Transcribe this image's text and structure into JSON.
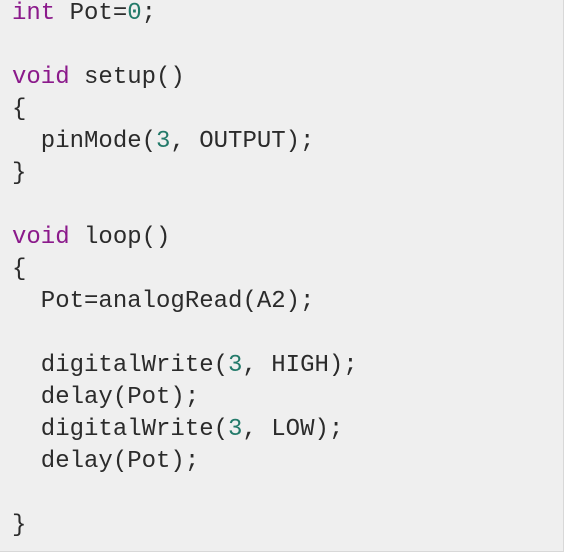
{
  "code_lines": [
    [
      {
        "t": "int",
        "c": "kw"
      },
      {
        "t": " Pot=",
        "c": "txt"
      },
      {
        "t": "0",
        "c": "num"
      },
      {
        "t": ";",
        "c": "txt"
      }
    ],
    [],
    [
      {
        "t": "void",
        "c": "kw"
      },
      {
        "t": " setup()",
        "c": "txt"
      }
    ],
    [
      {
        "t": "{",
        "c": "txt"
      }
    ],
    [
      {
        "t": "  pinMode(",
        "c": "txt"
      },
      {
        "t": "3",
        "c": "num"
      },
      {
        "t": ", OUTPUT);",
        "c": "txt"
      }
    ],
    [
      {
        "t": "}",
        "c": "txt"
      }
    ],
    [],
    [
      {
        "t": "void",
        "c": "kw"
      },
      {
        "t": " loop()",
        "c": "txt"
      }
    ],
    [
      {
        "t": "{",
        "c": "txt"
      }
    ],
    [
      {
        "t": "  Pot=analogRead(A2);",
        "c": "txt"
      }
    ],
    [],
    [
      {
        "t": "  digitalWrite(",
        "c": "txt"
      },
      {
        "t": "3",
        "c": "num"
      },
      {
        "t": ", HIGH);",
        "c": "txt"
      }
    ],
    [
      {
        "t": "  delay(Pot);",
        "c": "txt"
      }
    ],
    [
      {
        "t": "  digitalWrite(",
        "c": "txt"
      },
      {
        "t": "3",
        "c": "num"
      },
      {
        "t": ", LOW);",
        "c": "txt"
      }
    ],
    [
      {
        "t": "  delay(Pot);",
        "c": "txt"
      }
    ],
    [],
    [
      {
        "t": "}",
        "c": "txt"
      }
    ]
  ],
  "colors": {
    "keyword": "#8b1a8b",
    "number": "#237a6a",
    "text": "#2b2b2b",
    "background": "#efefef"
  }
}
